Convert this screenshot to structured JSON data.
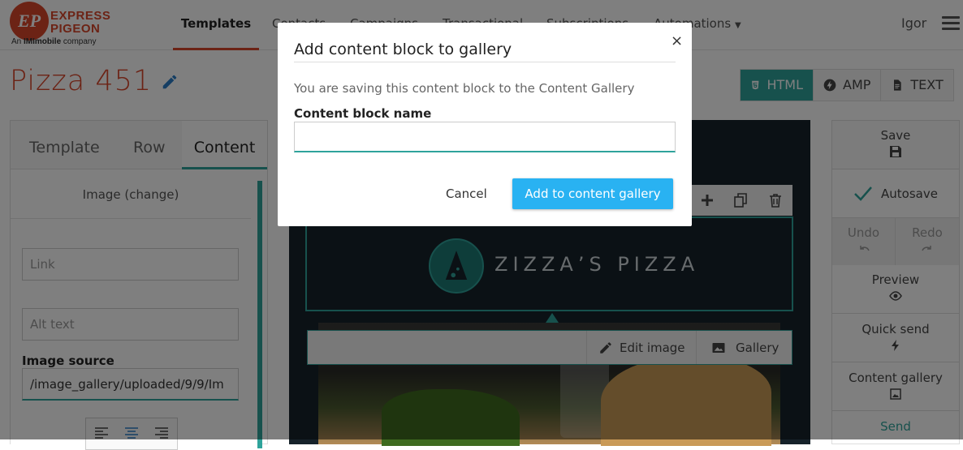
{
  "brand": {
    "logo_letters": "EP",
    "name_line1": "Express",
    "name_line2": "Pigeon",
    "tagline_prefix": "An ",
    "tagline_brand": "IMImobile",
    "tagline_suffix": " company"
  },
  "nav": {
    "items": [
      {
        "label": "Templates",
        "active": true
      },
      {
        "label": "Contacts"
      },
      {
        "label": "Campaigns"
      },
      {
        "label": "Transactional"
      },
      {
        "label": "Subscriptions"
      },
      {
        "label": "Automations"
      }
    ],
    "user": "Igor",
    "menu_icon": "hamburger-icon"
  },
  "page": {
    "title": "Pizza 451",
    "modes": [
      {
        "label": "HTML",
        "icon": "html5-icon",
        "active": true
      },
      {
        "label": "AMP",
        "icon": "bolt-icon"
      },
      {
        "label": "TEXT",
        "icon": "document-icon"
      }
    ]
  },
  "left_panel": {
    "tabs": [
      "Template",
      "Row",
      "Content"
    ],
    "active_tab": "Content",
    "image_change": "Image (change)",
    "link_placeholder": "Link",
    "alt_placeholder": "Alt text",
    "image_source_label": "Image source",
    "image_source_value": "/image_gallery/uploaded/9/9/Im"
  },
  "canvas": {
    "brand_text": "ZIZZA’S PIZZA",
    "edit_image": "Edit image",
    "gallery": "Gallery"
  },
  "right_panel": {
    "save": "Save",
    "autosave": "Autosave",
    "undo": "Undo",
    "redo": "Redo",
    "preview": "Preview",
    "quick_send": "Quick send",
    "content_gallery": "Content gallery",
    "send": "Send"
  },
  "modal": {
    "title": "Add content block to gallery",
    "close": "×",
    "description": "You are saving this content block to the Content Gallery",
    "name_label": "Content block name",
    "name_value": "",
    "cancel": "Cancel",
    "add": "Add to content gallery"
  },
  "colors": {
    "brand_red": "#d9462b",
    "teal": "#2fa39b",
    "primary_blue": "#29b2f2",
    "canvas_dark": "#16222a"
  }
}
